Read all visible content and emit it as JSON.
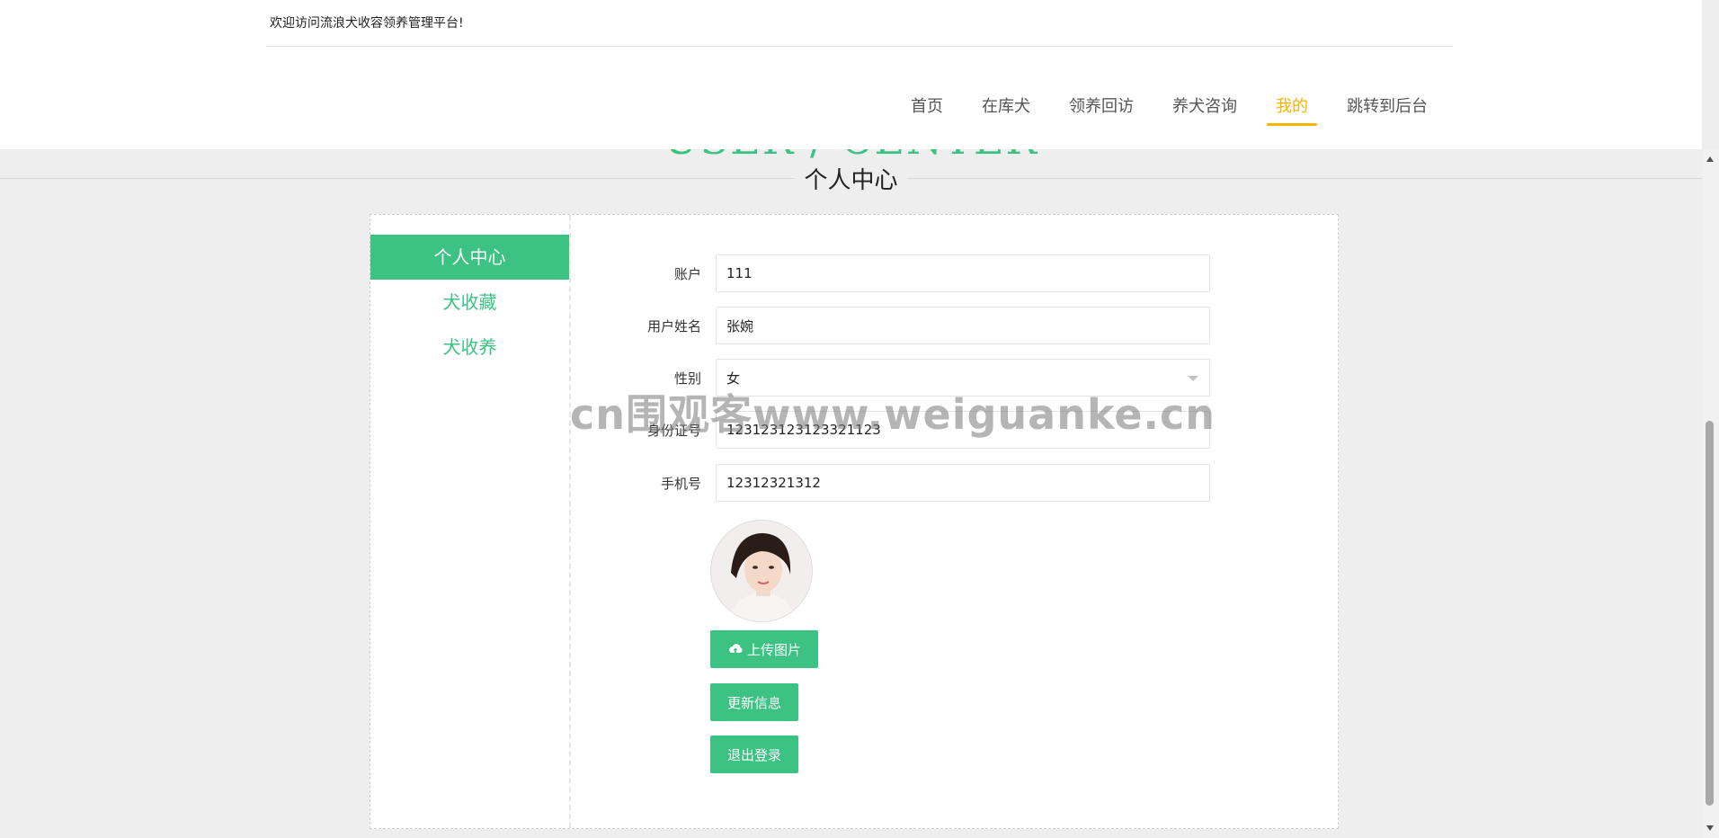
{
  "header": {
    "welcome": "欢迎访问流浪犬收容领养管理平台!",
    "nav": [
      {
        "label": "首页"
      },
      {
        "label": "在库犬"
      },
      {
        "label": "领养回访"
      },
      {
        "label": "养犬咨询"
      },
      {
        "label": "我的"
      },
      {
        "label": "跳转到后台"
      }
    ]
  },
  "page": {
    "title_bg": "USER / CENTER",
    "title": "个人中心"
  },
  "sidebar": {
    "items": [
      {
        "label": "个人中心"
      },
      {
        "label": "犬收藏"
      },
      {
        "label": "犬收养"
      }
    ]
  },
  "form": {
    "account": {
      "label": "账户",
      "value": "111"
    },
    "name": {
      "label": "用户姓名",
      "value": "张婉"
    },
    "gender": {
      "label": "性别",
      "value": "女"
    },
    "idcard": {
      "label": "身份证号",
      "value": "123123123123321123"
    },
    "phone": {
      "label": "手机号",
      "value": "12312321312"
    }
  },
  "buttons": {
    "upload": "上传图片",
    "update": "更新信息",
    "logout": "退出登录"
  },
  "watermark": "cn围观客www.weiguanke.cn",
  "colors": {
    "accent": "#3cc383",
    "nav_active": "#f5b400"
  }
}
